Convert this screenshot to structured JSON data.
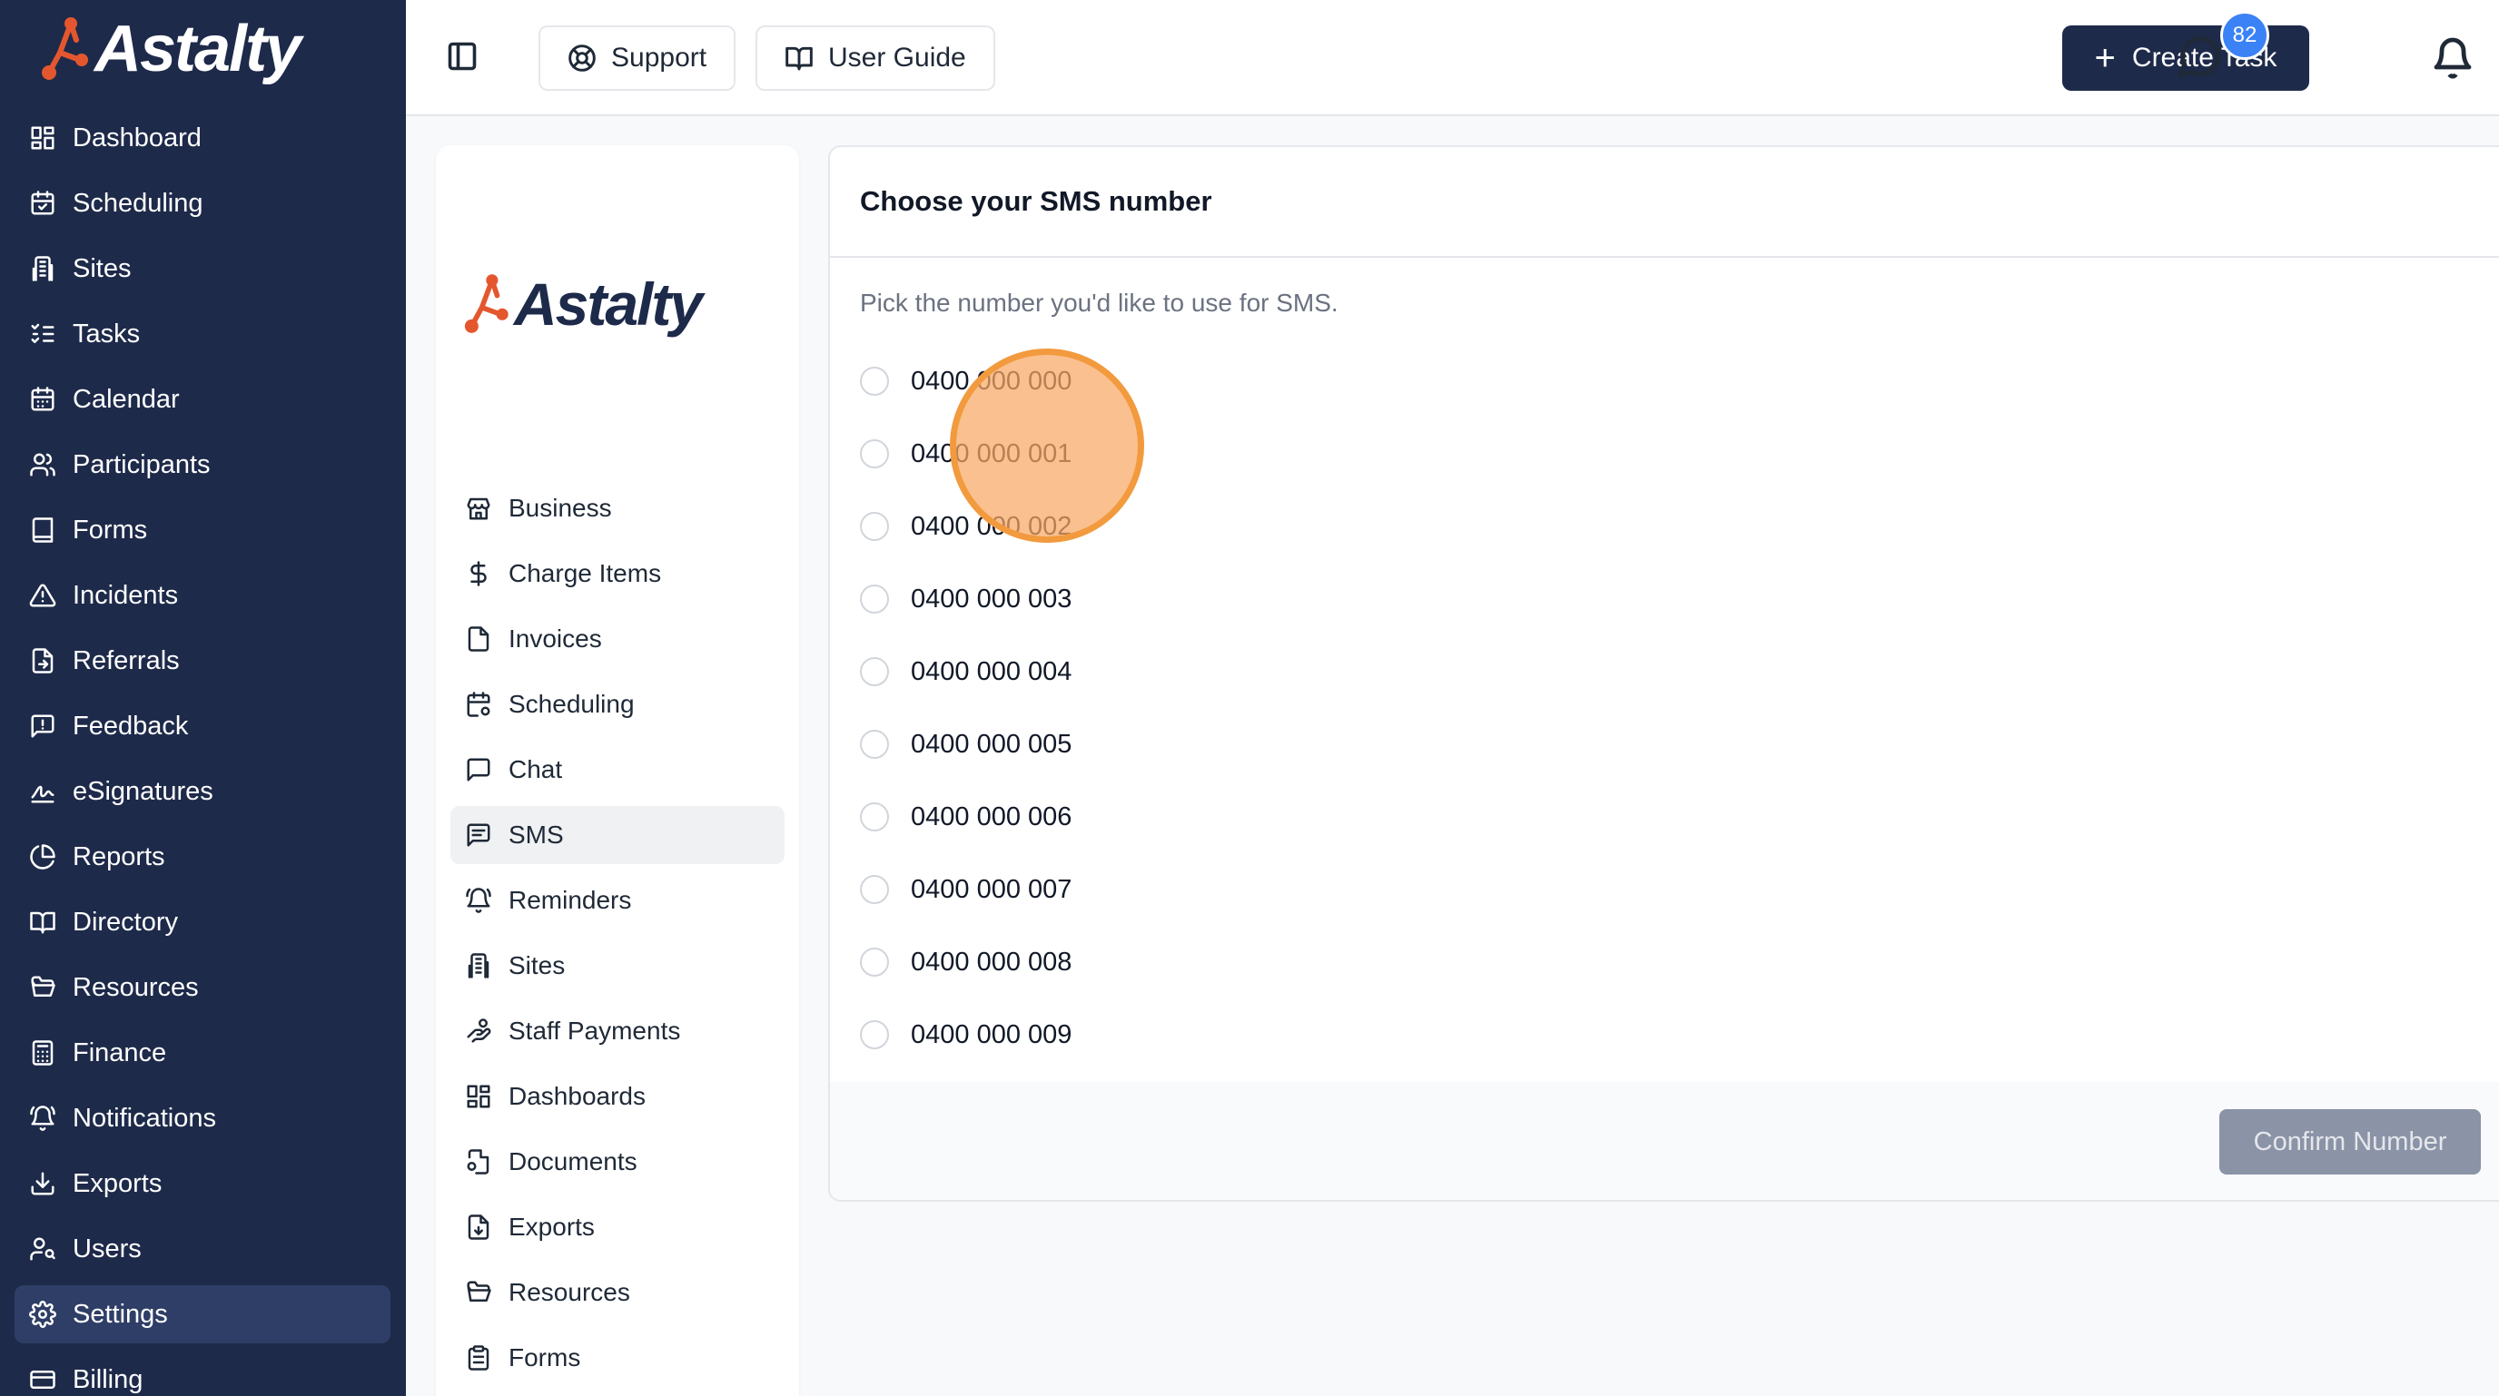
{
  "brand": {
    "name": "Astalty",
    "accent_color": "#e4572e",
    "sidebar_color": "#1e2a4a"
  },
  "sidebar": {
    "items": [
      {
        "label": "Dashboard",
        "icon": "grid-icon"
      },
      {
        "label": "Scheduling",
        "icon": "calendar-check-icon"
      },
      {
        "label": "Sites",
        "icon": "building-icon"
      },
      {
        "label": "Tasks",
        "icon": "list-check-icon"
      },
      {
        "label": "Calendar",
        "icon": "calendar-icon"
      },
      {
        "label": "Participants",
        "icon": "users-icon"
      },
      {
        "label": "Forms",
        "icon": "book-icon"
      },
      {
        "label": "Incidents",
        "icon": "warning-triangle-icon"
      },
      {
        "label": "Referrals",
        "icon": "file-export-icon"
      },
      {
        "label": "Feedback",
        "icon": "message-alert-icon"
      },
      {
        "label": "eSignatures",
        "icon": "signature-icon"
      },
      {
        "label": "Reports",
        "icon": "pie-chart-icon"
      },
      {
        "label": "Directory",
        "icon": "open-book-icon"
      },
      {
        "label": "Resources",
        "icon": "folder-open-icon"
      },
      {
        "label": "Finance",
        "icon": "calculator-icon"
      },
      {
        "label": "Notifications",
        "icon": "bell-ring-icon"
      },
      {
        "label": "Exports",
        "icon": "download-icon"
      },
      {
        "label": "Users",
        "icon": "user-key-icon"
      },
      {
        "label": "Settings",
        "icon": "gear-icon"
      },
      {
        "label": "Billing",
        "icon": "credit-card-icon"
      }
    ],
    "active": "Settings"
  },
  "topbar": {
    "support_label": "Support",
    "guide_label": "User Guide",
    "create_label": "Create Task",
    "chat_badge": "82"
  },
  "settings_nav": {
    "items": [
      {
        "label": "Business",
        "icon": "store-icon"
      },
      {
        "label": "Charge Items",
        "icon": "dollar-icon"
      },
      {
        "label": "Invoices",
        "icon": "file-icon"
      },
      {
        "label": "Scheduling",
        "icon": "calendar-gear-icon"
      },
      {
        "label": "Chat",
        "icon": "chat-square-icon"
      },
      {
        "label": "SMS",
        "icon": "message-text-icon"
      },
      {
        "label": "Reminders",
        "icon": "bell-ring-icon"
      },
      {
        "label": "Sites",
        "icon": "building-icon"
      },
      {
        "label": "Staff Payments",
        "icon": "hand-coins-icon"
      },
      {
        "label": "Dashboards",
        "icon": "grid-icon"
      },
      {
        "label": "Documents",
        "icon": "file-settings-icon"
      },
      {
        "label": "Exports",
        "icon": "file-download-icon"
      },
      {
        "label": "Resources",
        "icon": "folder-open-icon"
      },
      {
        "label": "Forms",
        "icon": "clipboard-icon"
      }
    ],
    "active": "SMS"
  },
  "sms_card": {
    "title": "Choose your SMS number",
    "description": "Pick the number you'd like to use for SMS.",
    "numbers": [
      "0400 000 000",
      "0400 000 001",
      "0400 000 002",
      "0400 000 003",
      "0400 000 004",
      "0400 000 005",
      "0400 000 006",
      "0400 000 007",
      "0400 000 008",
      "0400 000 009"
    ],
    "selected": null,
    "confirm_label": "Confirm Number",
    "confirm_disabled": true
  }
}
